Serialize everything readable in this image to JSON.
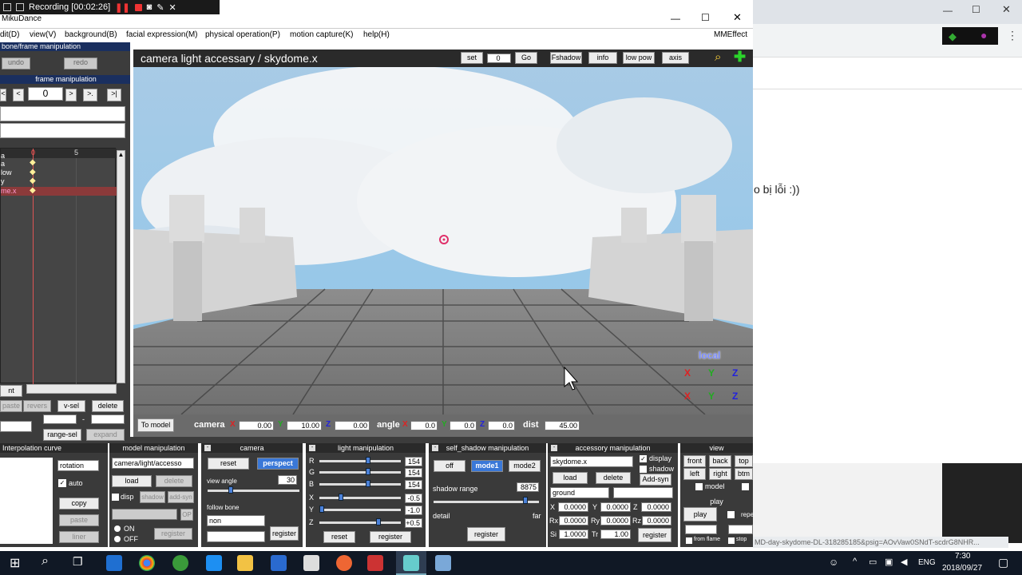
{
  "recording": {
    "label": "Recording [00:02:26]"
  },
  "window": {
    "title": "MikuDance",
    "effect_menu": "MMEffect"
  },
  "menu": [
    "dit(D)",
    "view(V)",
    "background(B)",
    "facial expression(M)",
    "physical operation(P)",
    "motion capture(K)",
    "help(H)"
  ],
  "left": {
    "bone_frame_header": "bone/frame manipulation",
    "undo": "undo",
    "redo": "redo",
    "frame_manipulation": "frame manipulation",
    "frame_value": "0",
    "nav": [
      "<",
      "<",
      ">",
      ">.",
      ">|"
    ],
    "ruler": [
      "0",
      "5"
    ],
    "tracks": [
      "a",
      "low",
      "y",
      "me.x"
    ],
    "bottom_buttons": {
      "nt": "nt",
      "paste": "paste",
      "revers": "revers",
      "v_sel": "v-sel",
      "delete": "delete",
      "range_sel": "range-sel",
      "expand": "expand",
      "dash": "-"
    }
  },
  "viewport": {
    "title": "camera light accessary / skydome.x",
    "set_label": "set",
    "set_value": "0",
    "go": "Go",
    "fshadow": "Fshadow",
    "info": "info",
    "low_pow": "low pow",
    "axis": "axis",
    "local": "local",
    "axes": [
      "X",
      "Y",
      "Z"
    ]
  },
  "footer": {
    "to_model": "To model",
    "camera_label": "camera",
    "camera": [
      {
        "axis": "X",
        "value": "0.00"
      },
      {
        "axis": "Y",
        "value": "10.00"
      },
      {
        "axis": "Z",
        "value": "0.00"
      }
    ],
    "angle_label": "angle",
    "angle": [
      {
        "axis": "X",
        "value": "0.0"
      },
      {
        "axis": "Y",
        "value": "0.0"
      },
      {
        "axis": "Z",
        "value": "0.0"
      }
    ],
    "dist_label": "dist",
    "dist_value": "45.00"
  },
  "interp": {
    "title": "Interpolation curve",
    "select": "rotation",
    "auto": "auto",
    "copy": "copy",
    "paste": "paste",
    "liner": "liner"
  },
  "model": {
    "title": "model manipulation",
    "select": "camera/light/accesso",
    "load": "load",
    "delete": "delete",
    "disp": "disp",
    "shadow": "shadow",
    "add_syn": "add-syn",
    "op": "OP",
    "on": "ON",
    "off": "OFF",
    "register": "register"
  },
  "camera": {
    "title": "camera",
    "reset": "reset",
    "perspect": "perspect",
    "view_angle": "view angle",
    "view_angle_value": "30",
    "follow_bone": "follow bone",
    "follow_select": "non",
    "register": "register"
  },
  "light": {
    "title": "light manipulation",
    "rows": [
      {
        "l": "R",
        "v": "154"
      },
      {
        "l": "G",
        "v": "154"
      },
      {
        "l": "B",
        "v": "154"
      },
      {
        "l": "X",
        "v": "-0.5"
      },
      {
        "l": "Y",
        "v": "-1.0"
      },
      {
        "l": "Z",
        "v": "+0.5"
      }
    ],
    "reset": "reset",
    "register": "register"
  },
  "shadow": {
    "title": "self_shadow manipulation",
    "off": "off",
    "mode1": "mode1",
    "mode2": "mode2",
    "range": "shadow range",
    "range_value": "8875",
    "detail": "detail",
    "far": "far",
    "register": "register"
  },
  "accessory": {
    "title": "accessory manipulation",
    "select": "skydome.x",
    "display": "display",
    "shadow": "shadow",
    "load": "load",
    "delete": "delete",
    "add_syn": "Add-syn",
    "ground": "ground",
    "pos": [
      {
        "l": "X",
        "v": "0.0000"
      },
      {
        "l": "Y",
        "v": "0.0000"
      },
      {
        "l": "Z",
        "v": "0.0000"
      }
    ],
    "rot": [
      {
        "l": "Rx",
        "v": "0.0000"
      },
      {
        "l": "Ry",
        "v": "0.0000"
      },
      {
        "l": "Rz",
        "v": "0.0000"
      }
    ],
    "si_label": "Si",
    "si": "1.0000",
    "tr_label": "Tr",
    "tr": "1.00",
    "register": "register"
  },
  "view": {
    "title": "view",
    "front": "front",
    "back": "back",
    "top": "top",
    "left": "left",
    "right": "right",
    "btm": "btm",
    "model": "model",
    "play_title": "play",
    "play": "play",
    "repeat": "repe",
    "from_flame": "from flame",
    "stop": "stop"
  },
  "browser": {
    "text": "o bị lỗi :))",
    "status_url": "MD-day-skydome-DL-318285185&psig=AOvVaw0SNdT-scdrG8NHR..."
  },
  "taskbar": {
    "time": "7:30",
    "date": "2018/09/27",
    "lang": "ENG"
  }
}
